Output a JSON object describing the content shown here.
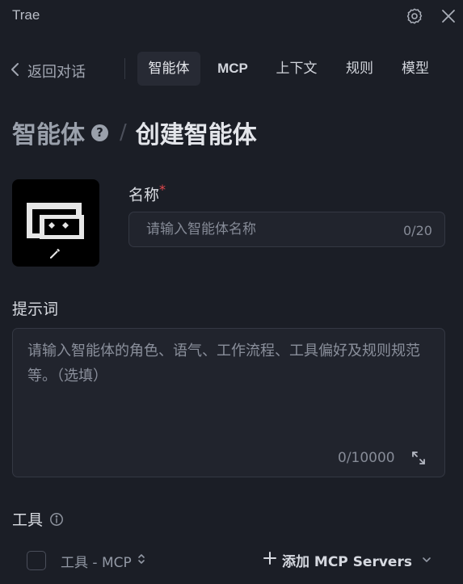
{
  "app": {
    "title": "Trae"
  },
  "nav": {
    "back_label": "返回对话",
    "tabs": [
      {
        "label": "智能体",
        "active": true
      },
      {
        "label": "MCP",
        "active": false
      },
      {
        "label": "上下文",
        "active": false
      },
      {
        "label": "规则",
        "active": false
      },
      {
        "label": "模型",
        "active": false
      }
    ]
  },
  "breadcrumb": {
    "root": "智能体",
    "separator": "/",
    "current": "创建智能体"
  },
  "form": {
    "name": {
      "label": "名称",
      "required_mark": "*",
      "placeholder": "请输入智能体名称",
      "value": "",
      "counter": "0/20"
    },
    "prompt": {
      "label": "提示词",
      "placeholder": "请输入智能体的角色、语气、工作流程、工具偏好及规则规范等。（选填）",
      "value": "",
      "counter": "0/10000"
    },
    "tools": {
      "label": "工具",
      "column_header": "工具 - MCP",
      "add_label": "添加 MCP Servers"
    }
  },
  "colors": {
    "background": "#1b1e26",
    "input_bg": "#21242d",
    "required": "#e5484d",
    "active_tab_bg": "#272a34"
  },
  "icons": [
    "gear-icon",
    "close-icon",
    "chevron-left-icon",
    "help-icon",
    "edit-pencil-icon",
    "expand-icon",
    "info-icon",
    "sort-icon",
    "plus-icon",
    "chevron-down-icon"
  ]
}
